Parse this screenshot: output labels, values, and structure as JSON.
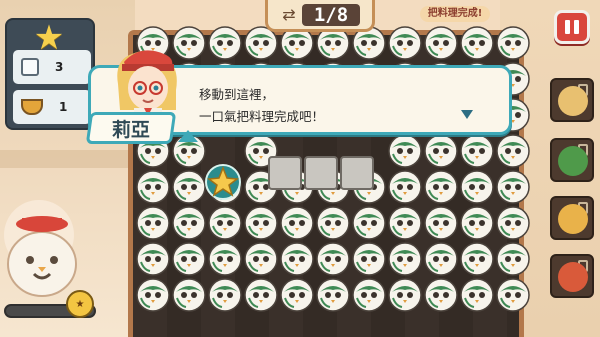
{
  "hud": {
    "moves_current": "1",
    "moves_total": "8",
    "moves_display": "1/8",
    "goal_label": "把料理完成!",
    "star_icon": "star-icon"
  },
  "left_panel": {
    "slots": [
      {
        "icon": "square-icon",
        "count": "3"
      },
      {
        "icon": "pot-icon",
        "count": "1"
      }
    ]
  },
  "dialog": {
    "speaker": "莉亞",
    "lines": [
      "移動到這裡，",
      "一口氣把料理完成吧！"
    ],
    "next_icon": "triangle-down-icon"
  },
  "progress": {
    "level": 0.0
  },
  "colors": {
    "accent": "#3ea9b8",
    "pause": "#d9463d",
    "board": "#2d2520"
  }
}
